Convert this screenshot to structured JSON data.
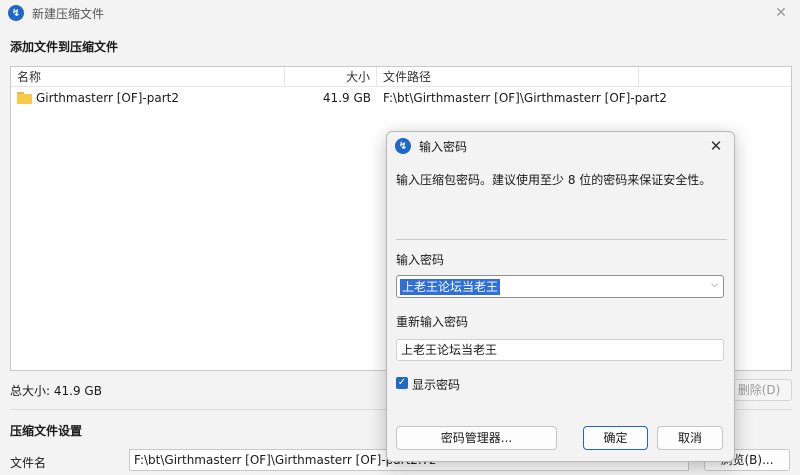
{
  "window": {
    "title": "新建压缩文件",
    "close": "✕"
  },
  "add_section": {
    "title": "添加文件到压缩文件"
  },
  "table": {
    "headers": {
      "name": "名称",
      "size": "大小",
      "path": "文件路径"
    },
    "rows": [
      {
        "name": "Girthmasterr [OF]-part2",
        "size": "41.9 GB",
        "path": "F:\\bt\\Girthmasterr [OF]\\Girthmasterr [OF]-part2"
      }
    ]
  },
  "total_size": "总大小: 41.9 GB",
  "delete_button": "删除(D)",
  "settings_section": {
    "title": "压缩文件设置"
  },
  "filename": {
    "label": "文件名",
    "value": "F:\\bt\\Girthmasterr [OF]\\Girthmasterr [OF]-part2.7z"
  },
  "browse_button": "浏览(B)...",
  "dialog": {
    "title": "输入密码",
    "close": "✕",
    "description": "输入压缩包密码。建议使用至少 8 位的密码来保证安全性。",
    "password_label": "输入密码",
    "password_value": "上老王论坛当老王",
    "reenter_label": "重新输入密码",
    "reenter_value": "上老王论坛当老王",
    "show_password": "显示密码",
    "manager_button": "密码管理器...",
    "ok_button": "确定",
    "cancel_button": "取消"
  },
  "icons": {
    "app": "app-logo-icon",
    "folder": "folder-icon",
    "chevron": "chevron-down-icon",
    "check": "checkmark-icon"
  },
  "colors": {
    "accent": "#2067c9",
    "selection": "#2f6fd6"
  }
}
